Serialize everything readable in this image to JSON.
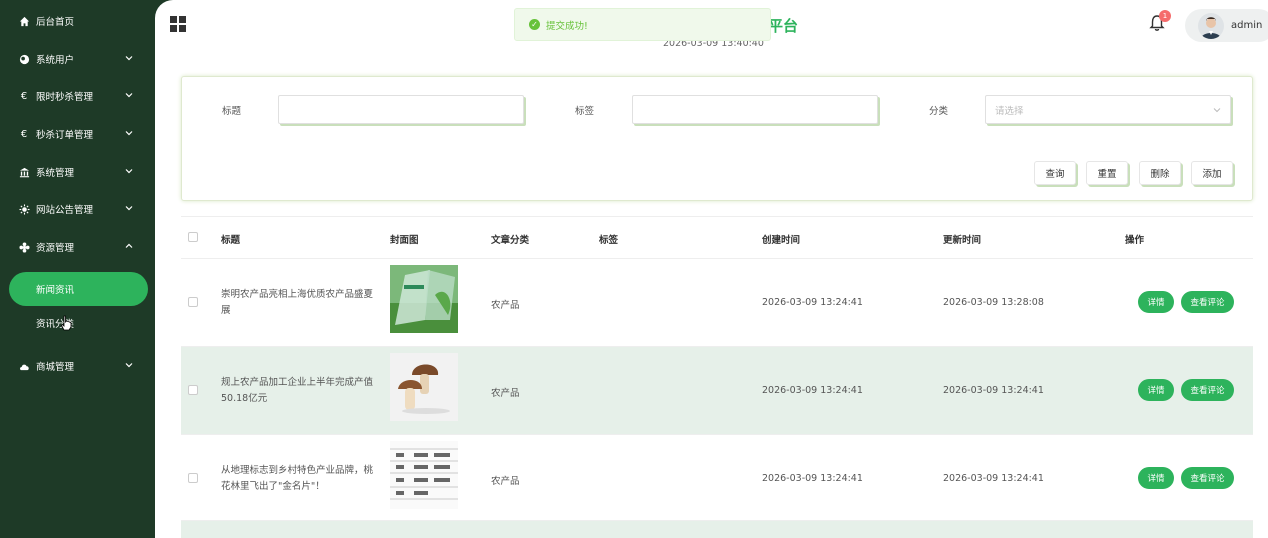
{
  "sidebar": {
    "items": [
      {
        "label": "后台首页",
        "icon": "home-icon"
      },
      {
        "label": "系统用户",
        "icon": "user-icon"
      },
      {
        "label": "限时秒杀管理",
        "icon": "euro-icon"
      },
      {
        "label": "秒杀订单管理",
        "icon": "euro-icon"
      },
      {
        "label": "系统管理",
        "icon": "bank-icon"
      },
      {
        "label": "网站公告管理",
        "icon": "sun-icon"
      },
      {
        "label": "资源管理",
        "icon": "plus-icon"
      },
      {
        "label": "商城管理",
        "icon": "cloud-icon"
      }
    ],
    "sub_items": [
      {
        "label": "新闻资讯",
        "active": true
      },
      {
        "label": "资讯分类",
        "active": false
      }
    ]
  },
  "header": {
    "title": "平台",
    "datetime": "2026-03-09 13:40:40",
    "toast": "提交成功!",
    "notification_count": "1",
    "username": "admin"
  },
  "search": {
    "title_label": "标题",
    "tag_label": "标签",
    "category_label": "分类",
    "category_placeholder": "请选择",
    "buttons": [
      "查询",
      "重置",
      "删除",
      "添加"
    ]
  },
  "table": {
    "headers": [
      "标题",
      "封面图",
      "文章分类",
      "标签",
      "创建时间",
      "更新时间",
      "操作"
    ],
    "rows": [
      {
        "title": "崇明农产品亮相上海优质农产品盛夏展",
        "category": "农产品",
        "tag": "",
        "created": "2026-03-09 13:24:41",
        "updated": "2026-03-09 13:28:08"
      },
      {
        "title": "规上农产品加工企业上半年完成产值50.18亿元",
        "category": "农产品",
        "tag": "",
        "created": "2026-03-09 13:24:41",
        "updated": "2026-03-09 13:24:41"
      },
      {
        "title": "从地理标志到乡村特色产业品牌，桃花林里飞出了\"金名片\"！",
        "category": "农产品",
        "tag": "",
        "created": "2026-03-09 13:24:41",
        "updated": "2026-03-09 13:24:41"
      }
    ],
    "action_detail": "详情",
    "action_comments": "查看评论"
  },
  "colors": {
    "sidebar_bg": "#1e3a27",
    "accent": "#2db35c",
    "row_highlight": "#e6f0e9",
    "toast_text": "#67c23a",
    "badge": "#f56c6c"
  }
}
